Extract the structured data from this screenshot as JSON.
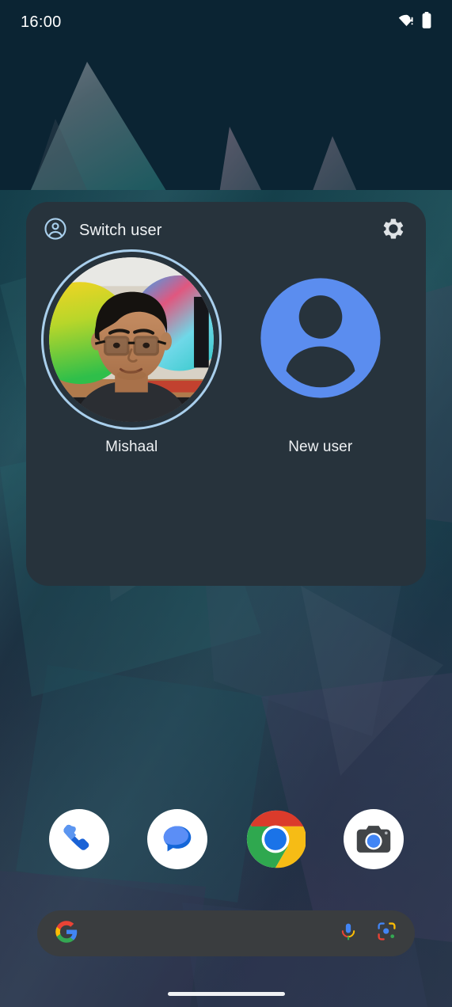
{
  "statusbar": {
    "clock": "16:00",
    "icons": [
      {
        "name": "wifi-no-internet-icon",
        "label": "Wi-Fi no internet"
      },
      {
        "name": "battery-icon",
        "label": "Battery full"
      }
    ]
  },
  "dialog": {
    "title": "Switch user",
    "header_icon": "account-circle-icon",
    "settings_icon": "gear-icon",
    "accent_color": "#5b8def",
    "selected_ring_color": "#a9cfec",
    "background_color": "#27333c",
    "users": [
      {
        "name": "Mishaal",
        "avatar_type": "photo",
        "selected": true
      },
      {
        "name": "New user",
        "avatar_type": "add-person-icon",
        "selected": false
      }
    ]
  },
  "dock": {
    "apps": [
      {
        "name": "Phone",
        "icon": "phone-icon"
      },
      {
        "name": "Messages",
        "icon": "messages-icon"
      },
      {
        "name": "Chrome",
        "icon": "chrome-icon"
      },
      {
        "name": "Camera",
        "icon": "camera-icon"
      }
    ]
  },
  "search": {
    "logo_icon": "google-g-icon",
    "placeholder": "",
    "value": "",
    "actions": [
      {
        "name": "Voice search",
        "icon": "microphone-icon"
      },
      {
        "name": "Google Lens",
        "icon": "google-lens-icon"
      }
    ]
  },
  "navigation": {
    "gesture_pill": "home-gesture-pill"
  }
}
